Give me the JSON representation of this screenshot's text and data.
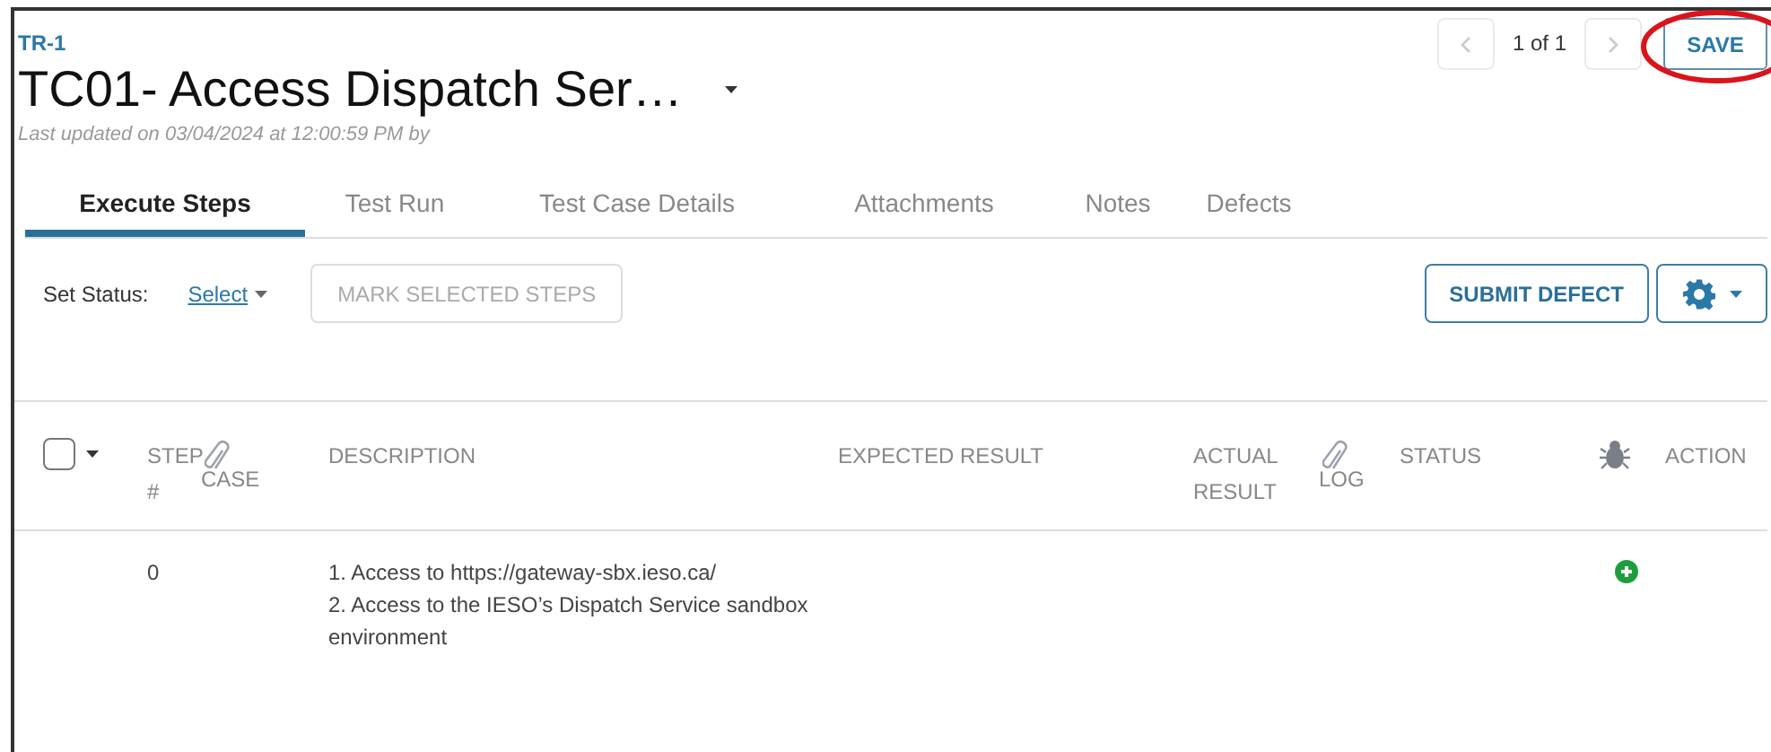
{
  "breadcrumb": "TR-1",
  "title": "TC01- Access Dispatch Ser…",
  "last_updated": "Last updated on 03/04/2024 at 12:00:59 PM by",
  "pager": {
    "text": "1 of 1",
    "prev_disabled": true,
    "next_disabled": true
  },
  "save_button": {
    "label": "SAVE",
    "circled": true
  },
  "tabs": [
    {
      "label": "Execute Steps",
      "selected": true
    },
    {
      "label": "Test Run",
      "selected": false
    },
    {
      "label": "Test Case Details",
      "selected": false
    },
    {
      "label": "Attachments",
      "selected": false
    },
    {
      "label": "Notes",
      "selected": false
    },
    {
      "label": "Defects",
      "selected": false
    }
  ],
  "toolbar": {
    "set_status_label": "Set Status:",
    "select_link": "Select",
    "mark_button": {
      "label": "MARK SELECTED STEPS",
      "disabled": true
    },
    "submit_defect": "SUBMIT DEFECT"
  },
  "table": {
    "select_all_checked": false,
    "columns": [
      {
        "kind": "text",
        "label": "STEP #"
      },
      {
        "kind": "clip",
        "label": "CASE"
      },
      {
        "kind": "text",
        "label": "DESCRIPTION"
      },
      {
        "kind": "text",
        "label": "EXPECTED RESULT"
      },
      {
        "kind": "text",
        "label": "ACTUAL RESULT"
      },
      {
        "kind": "clip",
        "label": "LOG"
      },
      {
        "kind": "text",
        "label": "STATUS"
      },
      {
        "kind": "bug"
      },
      {
        "kind": "text",
        "label": "ACTION"
      }
    ],
    "rows": [
      {
        "step": "0",
        "description": [
          "1. Access to https://gateway-sbx.ieso.ca/",
          "2. Access to the IESO’s Dispatch Service sandbox environment"
        ]
      }
    ]
  }
}
